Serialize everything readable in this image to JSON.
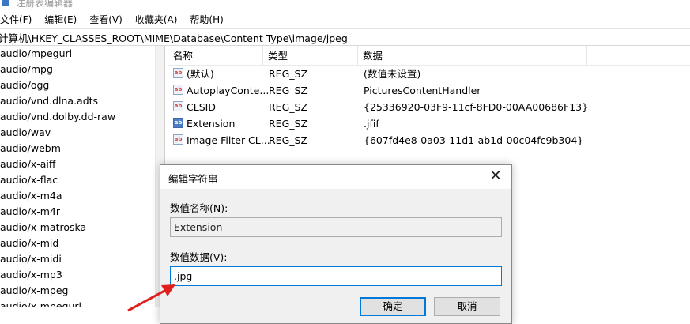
{
  "window": {
    "title": "注册表编辑器"
  },
  "menu": [
    "文件(F)",
    "编辑(E)",
    "查看(V)",
    "收藏夹(A)",
    "帮助(H)"
  ],
  "address": "计算机\\HKEY_CLASSES_ROOT\\MIME\\Database\\Content Type\\image/jpeg",
  "tree": [
    "audio/mpegurl",
    "audio/mpg",
    "audio/ogg",
    "audio/vnd.dlna.adts",
    "audio/vnd.dolby.dd-raw",
    "audio/wav",
    "audio/webm",
    "audio/x-aiff",
    "audio/x-flac",
    "audio/x-m4a",
    "audio/x-m4r",
    "audio/x-matroska",
    "audio/x-mid",
    "audio/x-midi",
    "audio/x-mp3",
    "audio/x-mpeg",
    "audio/x-mpegurl"
  ],
  "list": {
    "columns": [
      "名称",
      "类型",
      "数据"
    ],
    "rows": [
      {
        "name": "(默认)",
        "type": "REG_SZ",
        "data": "(数值未设置)",
        "icon": "string-value-icon"
      },
      {
        "name": "AutoplayConte...",
        "type": "REG_SZ",
        "data": "PicturesContentHandler",
        "icon": "string-value-icon"
      },
      {
        "name": "CLSID",
        "type": "REG_SZ",
        "data": "{25336920-03F9-11cf-8FD0-00AA00686F13}",
        "icon": "string-value-icon"
      },
      {
        "name": "Extension",
        "type": "REG_SZ",
        "data": ".jfif",
        "icon": "string-value-icon-selected"
      },
      {
        "name": "Image Filter CL...",
        "type": "REG_SZ",
        "data": "{607fd4e8-0a03-11d1-ab1d-00c04fc9b304}",
        "icon": "string-value-icon"
      }
    ]
  },
  "dialog": {
    "title": "编辑字符串",
    "name_label": "数值名称(N):",
    "name_value": "Extension",
    "data_label": "数值数据(V):",
    "data_value": ".jpg",
    "ok": "确定",
    "cancel": "取消"
  },
  "colors": {
    "accent": "#0078d7",
    "annotation": "#e02020"
  }
}
